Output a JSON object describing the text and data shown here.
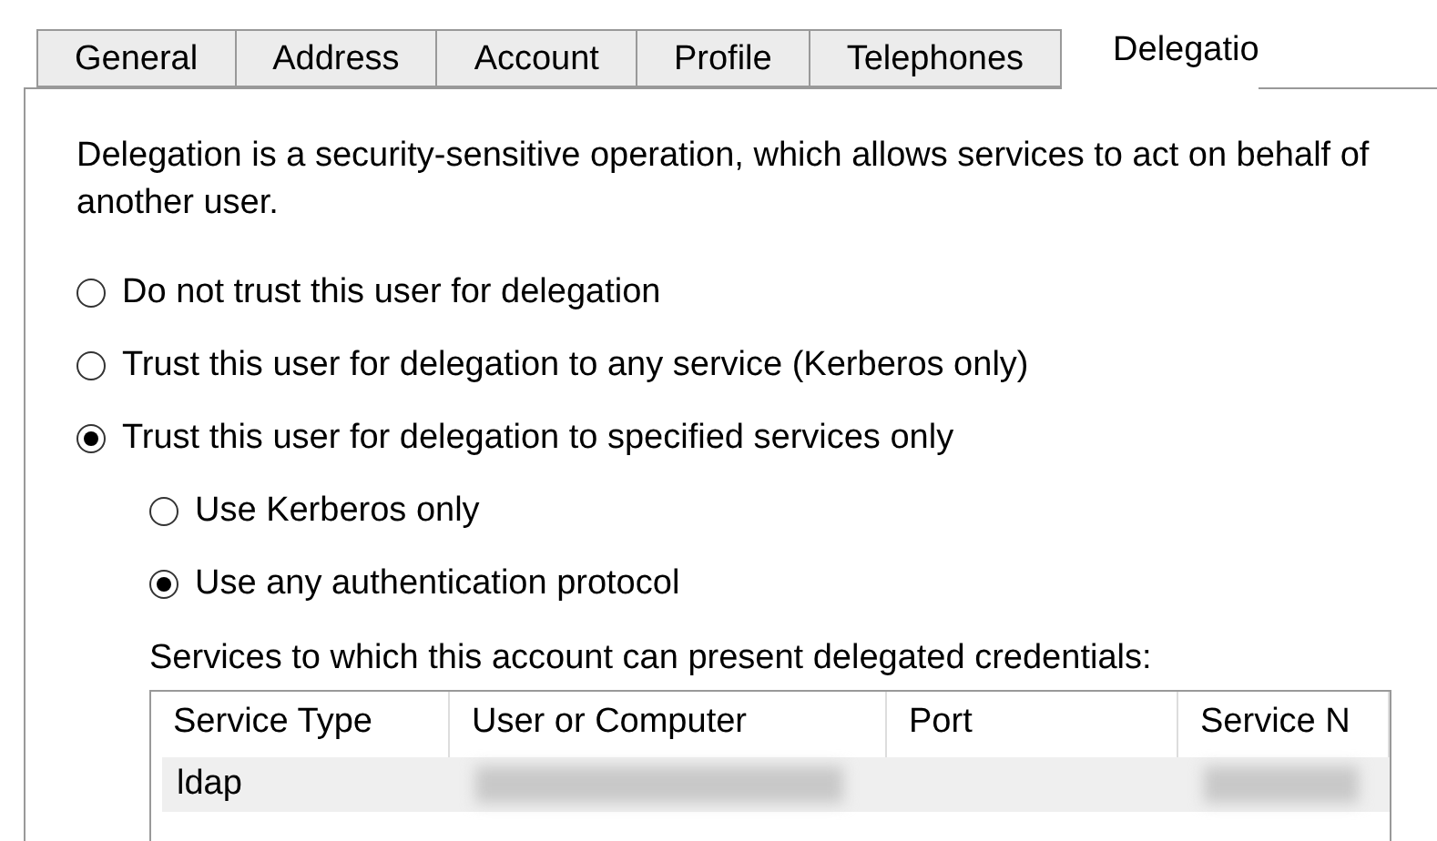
{
  "tabs": [
    {
      "label": "General",
      "selected": false
    },
    {
      "label": "Address",
      "selected": false
    },
    {
      "label": "Account",
      "selected": false
    },
    {
      "label": "Profile",
      "selected": false
    },
    {
      "label": "Telephones",
      "selected": false
    },
    {
      "label": "Delegatio",
      "selected": true
    }
  ],
  "description": "Delegation is a security-sensitive operation, which allows services to act on behalf of another user.",
  "options": [
    {
      "label": "Do not trust this user for delegation",
      "selected": false
    },
    {
      "label": "Trust this user for delegation to any service (Kerberos only)",
      "selected": false
    },
    {
      "label": "Trust this user for delegation to specified services only",
      "selected": true
    }
  ],
  "sub_options": [
    {
      "label": "Use Kerberos only",
      "selected": false
    },
    {
      "label": "Use any authentication protocol",
      "selected": true
    }
  ],
  "services_label": "Services to which this account can present delegated credentials:",
  "table": {
    "columns": [
      "Service Type",
      "User or Computer",
      "Port",
      "Service N"
    ],
    "rows": [
      [
        {
          "kind": "text",
          "text": "ldap"
        },
        {
          "kind": "redacted"
        },
        {
          "kind": "empty"
        },
        {
          "kind": "redacted"
        }
      ]
    ]
  }
}
